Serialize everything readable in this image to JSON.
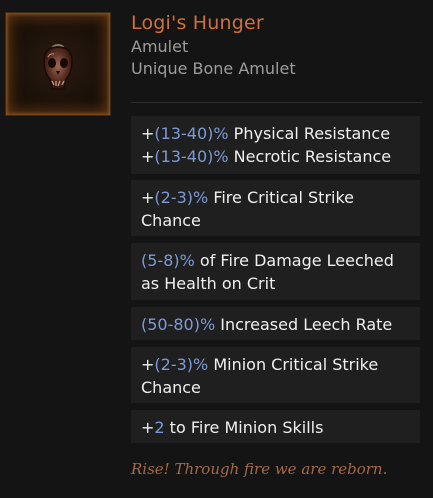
{
  "item": {
    "name": "Logi's Hunger",
    "type": "Amulet",
    "base": "Unique Bone Amulet",
    "icon": "bone-amulet-icon"
  },
  "affixes": [
    {
      "lines": [
        {
          "pre": "+",
          "range": "(13-40)%",
          "post": " Physical Resistance"
        },
        {
          "pre": "+",
          "range": "(13-40)%",
          "post": " Necrotic Resistance"
        }
      ]
    },
    {
      "lines": [
        {
          "pre": "+",
          "range": "(2-3)%",
          "post": " Fire Critical Strike"
        },
        {
          "pre": "",
          "range": "",
          "post": "Chance"
        }
      ]
    },
    {
      "lines": [
        {
          "pre": "",
          "range": "(5-8)%",
          "post": " of Fire Damage Leeched"
        },
        {
          "pre": "",
          "range": "",
          "post": "as Health on Crit"
        }
      ]
    },
    {
      "lines": [
        {
          "pre": "",
          "range": "(50-80)%",
          "post": " Increased Leech Rate"
        }
      ]
    },
    {
      "lines": [
        {
          "pre": "+",
          "range": "(2-3)%",
          "post": " Minion Critical Strike"
        },
        {
          "pre": "",
          "range": "",
          "post": "Chance"
        }
      ]
    },
    {
      "lines": [
        {
          "pre": "+",
          "range": "2",
          "post": " to Fire Minion Skills"
        }
      ]
    }
  ],
  "flavor_text": "Rise! Through fire we are reborn.",
  "colors": {
    "unique": "#d3703a",
    "range": "#7c9bd6",
    "flavor": "#a3694a"
  }
}
